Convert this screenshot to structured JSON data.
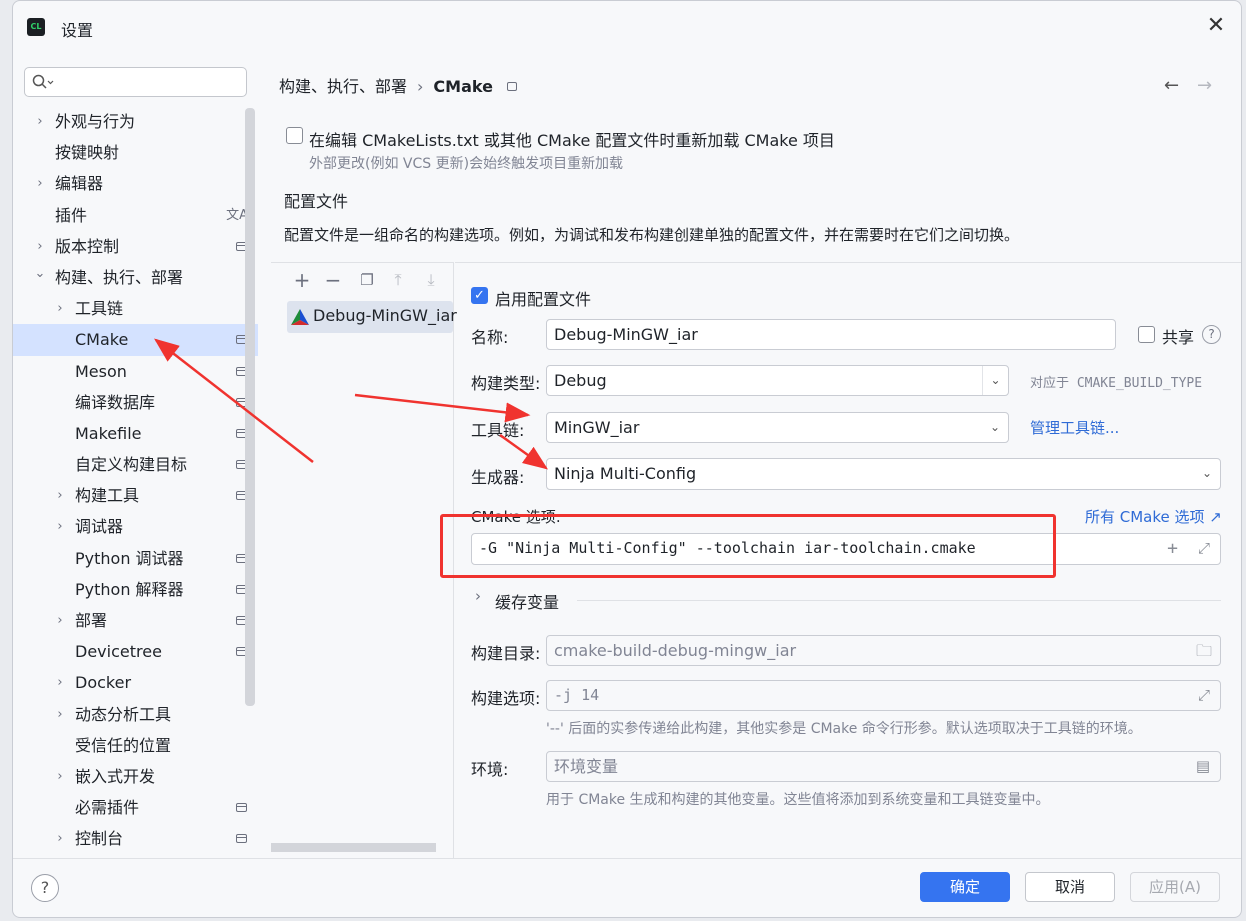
{
  "window": {
    "title": "设置"
  },
  "sidebar": {
    "items": [
      {
        "label": "外观与行为",
        "chevron": "›",
        "indent": 0
      },
      {
        "label": "按键映射",
        "chevron": "",
        "indent": 0
      },
      {
        "label": "编辑器",
        "chevron": "›",
        "indent": 0
      },
      {
        "label": "插件",
        "chevron": "",
        "indent": 0,
        "translate_icon": true
      },
      {
        "label": "版本控制",
        "chevron": "›",
        "indent": 0,
        "icon": true
      },
      {
        "label": "构建、执行、部署",
        "chevron": "⌄",
        "indent": 0
      },
      {
        "label": "工具链",
        "chevron": "›",
        "indent": 1
      },
      {
        "label": "CMake",
        "chevron": "",
        "indent": 1,
        "icon": true,
        "selected": true
      },
      {
        "label": "Meson",
        "chevron": "",
        "indent": 1,
        "icon": true
      },
      {
        "label": "编译数据库",
        "chevron": "",
        "indent": 1,
        "icon": true
      },
      {
        "label": "Makefile",
        "chevron": "",
        "indent": 1,
        "icon": true
      },
      {
        "label": "自定义构建目标",
        "chevron": "",
        "indent": 1,
        "icon": true
      },
      {
        "label": "构建工具",
        "chevron": "›",
        "indent": 1,
        "icon": true
      },
      {
        "label": "调试器",
        "chevron": "›",
        "indent": 1
      },
      {
        "label": "Python 调试器",
        "chevron": "",
        "indent": 1,
        "icon": true
      },
      {
        "label": "Python 解释器",
        "chevron": "",
        "indent": 1,
        "icon": true
      },
      {
        "label": "部署",
        "chevron": "›",
        "indent": 1,
        "icon": true
      },
      {
        "label": "Devicetree",
        "chevron": "",
        "indent": 1,
        "icon": true
      },
      {
        "label": "Docker",
        "chevron": "›",
        "indent": 1
      },
      {
        "label": "动态分析工具",
        "chevron": "›",
        "indent": 1
      },
      {
        "label": "受信任的位置",
        "chevron": "",
        "indent": 1
      },
      {
        "label": "嵌入式开发",
        "chevron": "›",
        "indent": 1
      },
      {
        "label": "必需插件",
        "chevron": "",
        "indent": 1,
        "icon": true
      },
      {
        "label": "控制台",
        "chevron": "›",
        "indent": 1,
        "icon": true
      }
    ]
  },
  "breadcrumb": {
    "parent": "构建、执行、部署",
    "separator": "›",
    "current": "CMake"
  },
  "reload": {
    "label": "在编辑 CMakeLists.txt 或其他 CMake 配置文件时重新加载 CMake 项目",
    "hint": "外部更改(例如 VCS 更新)会始终触发项目重新加载",
    "checked": false
  },
  "profiles_section": {
    "title": "配置文件",
    "description": "配置文件是一组命名的构建选项。例如，为调试和发布构建创建单独的配置文件，并在需要时在它们之间切换。"
  },
  "profile_list": [
    "Debug-MinGW_iar"
  ],
  "profile": {
    "enable_label": "启用配置文件",
    "enabled": true,
    "name_label": "名称:",
    "name_value": "Debug-MinGW_iar",
    "share_label": "共享",
    "build_type_label": "构建类型:",
    "build_type_value": "Debug",
    "build_type_hint": "对应于 CMAKE_BUILD_TYPE",
    "toolchain_label": "工具链:",
    "toolchain_value": "MinGW_iar",
    "manage_toolchains": "管理工具链...",
    "generator_label": "生成器:",
    "generator_value": "Ninja Multi-Config",
    "cmake_options_label": "CMake 选项:",
    "all_cmake_options": "所有 CMake 选项 ↗",
    "cmake_options_value": "-G \"Ninja Multi-Config\" --toolchain iar-toolchain.cmake",
    "cache_vars_label": "缓存变量",
    "build_dir_label": "构建目录:",
    "build_dir_value": "cmake-build-debug-mingw_iar",
    "build_opts_label": "构建选项:",
    "build_opts_value": "-j 14",
    "build_opts_hint": "'--' 后面的实参传递给此构建，其他实参是 CMake 命令行形参。默认选项取决于工具链的环境。",
    "env_label": "环境:",
    "env_placeholder": "环境变量",
    "env_hint": "用于 CMake 生成和构建的其他变量。这些值将添加到系统变量和工具链变量中。"
  },
  "footer": {
    "ok": "确定",
    "cancel": "取消",
    "apply": "应用(A)",
    "help": "?"
  },
  "colors": {
    "accent": "#3574f0",
    "annotation": "#f0332f",
    "selected_row": "#d4e2ff"
  }
}
